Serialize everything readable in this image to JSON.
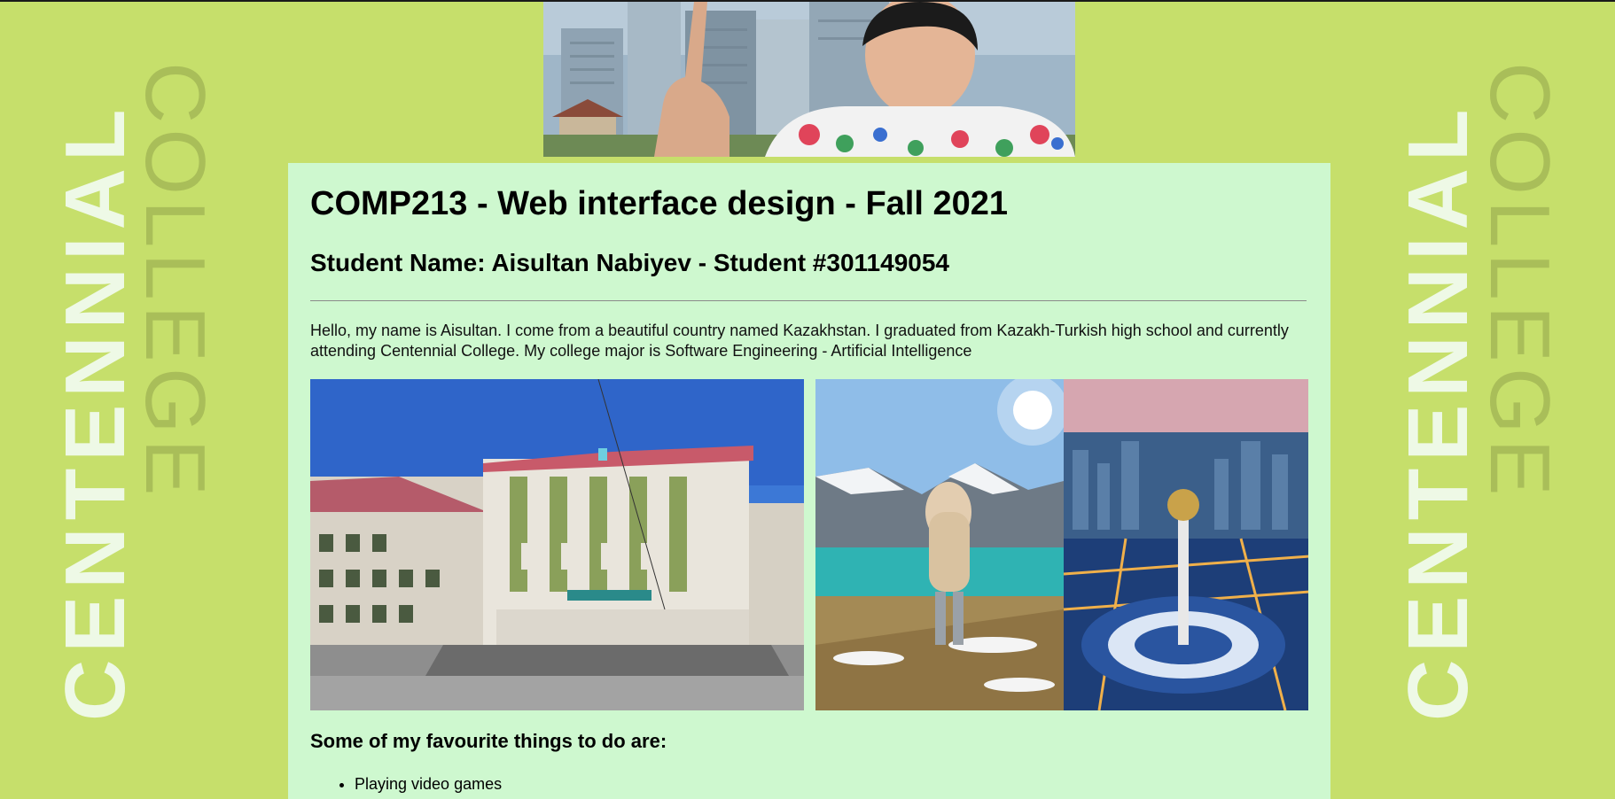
{
  "decor": {
    "centennial": "CENTENNIAL",
    "college": "COLLEGE"
  },
  "header": {
    "photo": "student-selfie"
  },
  "content": {
    "title": "COMP213 - Web interface design - Fall 2021",
    "student": "Student Name: Aisultan Nabiyev - Student #301149054",
    "intro": "Hello, my name is Aisultan. I come from a beautiful country named Kazakhstan. I graduated from Kazakh-Turkish high school and currently attending Centennial College. My college major is Software Engineering - Artificial Intelligence",
    "gallery": [
      {
        "name": "school-building-photo"
      },
      {
        "name": "mountain-lake-and-city-photo"
      }
    ],
    "favourites_heading": "Some of my favourite things to do are:",
    "favourites": [
      "Playing video games"
    ]
  },
  "colors": {
    "page_bg": "#c6df6b",
    "content_bg": "#cef8cf",
    "deco_light": "#eef9e6",
    "deco_dark": "#a9be59"
  }
}
